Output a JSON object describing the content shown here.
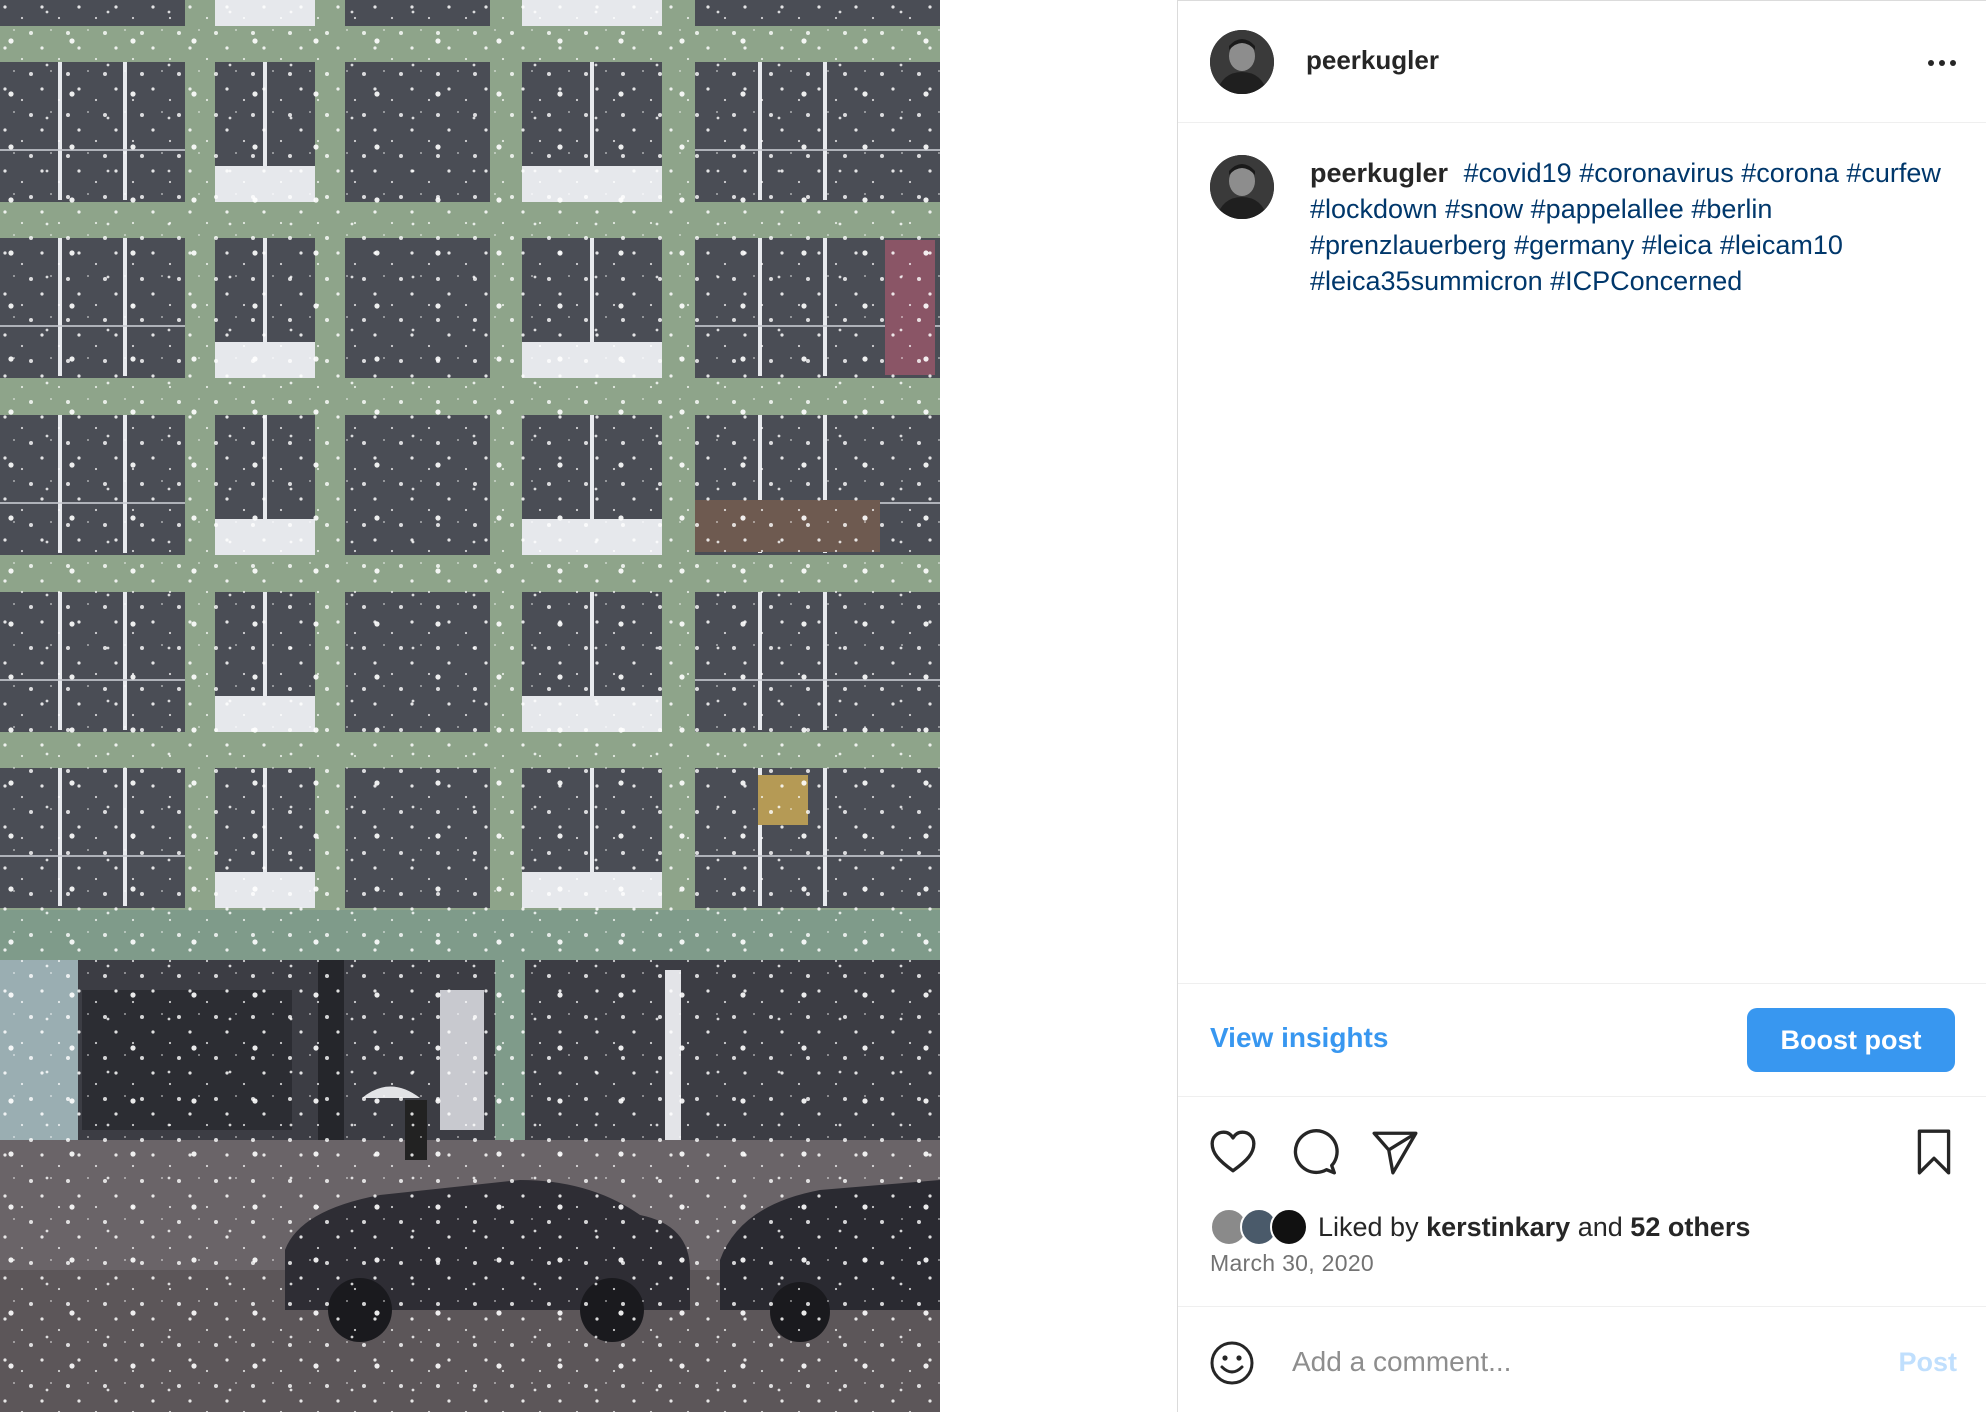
{
  "post": {
    "username": "peerkugler",
    "more_label": "…",
    "caption_user": "peerkugler",
    "hashtags": [
      "#covid19",
      "#coronavirus",
      "#corona",
      "#curfew",
      "#lockdown",
      "#snow",
      "#pappelallee",
      "#berlin",
      "#prenzlauerberg",
      "#germany",
      "#leica",
      "#leicam10",
      "#leica35summicron",
      "#ICPConcerned"
    ],
    "view_insights_label": "View insights",
    "boost_label": "Boost post",
    "likes": {
      "prefix": "Liked by",
      "user": "kerstinkary",
      "joiner": "and",
      "others": "52 others"
    },
    "date": "March 30, 2020",
    "comment_placeholder": "Add a comment...",
    "post_label": "Post"
  },
  "icons": {
    "like": "heart-icon",
    "comment": "comment-icon",
    "share": "paper-plane-icon",
    "save": "bookmark-icon",
    "emoji": "smiley-icon",
    "more": "more-options-icon"
  },
  "colors": {
    "link_blue": "#3897f0",
    "hashtag": "#00376b",
    "post_disabled": "#c0dffd",
    "divider": "#efefef"
  }
}
